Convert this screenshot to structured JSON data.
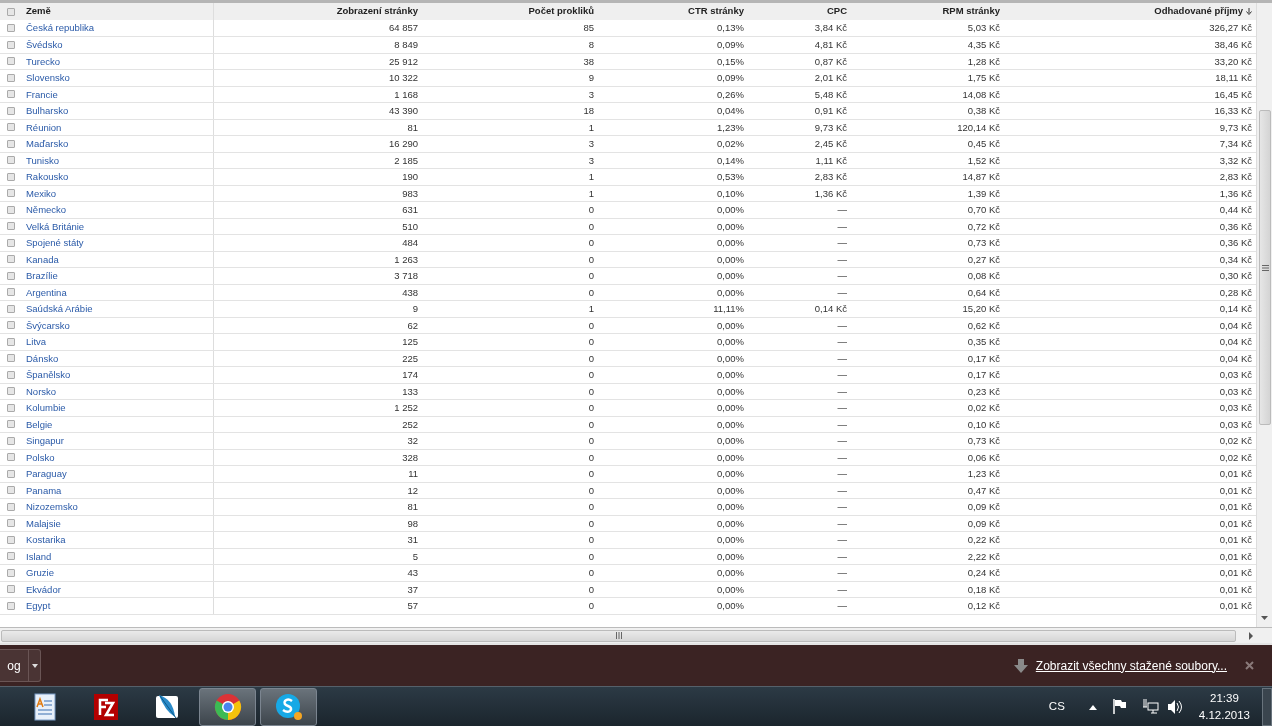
{
  "table": {
    "select_all_checked": false,
    "columns": [
      {
        "label": "Země",
        "sorted": false
      },
      {
        "label": "Zobrazení stránky",
        "sorted": false
      },
      {
        "label": "Počet prokliků",
        "sorted": false
      },
      {
        "label": "CTR stránky",
        "sorted": false
      },
      {
        "label": "CPC",
        "sorted": false
      },
      {
        "label": "RPM stránky",
        "sorted": false
      },
      {
        "label": "Odhadované příjmy",
        "sorted": true
      }
    ],
    "rows": [
      {
        "checked": false,
        "cells": [
          "Česká republika",
          "64 857",
          "85",
          "0,13%",
          "3,84 Kč",
          "5,03 Kč",
          "326,27 Kč"
        ]
      },
      {
        "checked": false,
        "cells": [
          "Švédsko",
          "8 849",
          "8",
          "0,09%",
          "4,81 Kč",
          "4,35 Kč",
          "38,46 Kč"
        ]
      },
      {
        "checked": false,
        "cells": [
          "Turecko",
          "25 912",
          "38",
          "0,15%",
          "0,87 Kč",
          "1,28 Kč",
          "33,20 Kč"
        ]
      },
      {
        "checked": false,
        "cells": [
          "Slovensko",
          "10 322",
          "9",
          "0,09%",
          "2,01 Kč",
          "1,75 Kč",
          "18,11 Kč"
        ]
      },
      {
        "checked": false,
        "cells": [
          "Francie",
          "1 168",
          "3",
          "0,26%",
          "5,48 Kč",
          "14,08 Kč",
          "16,45 Kč"
        ]
      },
      {
        "checked": false,
        "cells": [
          "Bulharsko",
          "43 390",
          "18",
          "0,04%",
          "0,91 Kč",
          "0,38 Kč",
          "16,33 Kč"
        ]
      },
      {
        "checked": false,
        "cells": [
          "Réunion",
          "81",
          "1",
          "1,23%",
          "9,73 Kč",
          "120,14 Kč",
          "9,73 Kč"
        ]
      },
      {
        "checked": false,
        "cells": [
          "Maďarsko",
          "16 290",
          "3",
          "0,02%",
          "2,45 Kč",
          "0,45 Kč",
          "7,34 Kč"
        ]
      },
      {
        "checked": false,
        "cells": [
          "Tunisko",
          "2 185",
          "3",
          "0,14%",
          "1,11 Kč",
          "1,52 Kč",
          "3,32 Kč"
        ]
      },
      {
        "checked": false,
        "cells": [
          "Rakousko",
          "190",
          "1",
          "0,53%",
          "2,83 Kč",
          "14,87 Kč",
          "2,83 Kč"
        ]
      },
      {
        "checked": false,
        "cells": [
          "Mexiko",
          "983",
          "1",
          "0,10%",
          "1,36 Kč",
          "1,39 Kč",
          "1,36 Kč"
        ]
      },
      {
        "checked": false,
        "cells": [
          "Německo",
          "631",
          "0",
          "0,00%",
          "—",
          "0,70 Kč",
          "0,44 Kč"
        ]
      },
      {
        "checked": false,
        "cells": [
          "Velká Británie",
          "510",
          "0",
          "0,00%",
          "—",
          "0,72 Kč",
          "0,36 Kč"
        ]
      },
      {
        "checked": false,
        "cells": [
          "Spojené státy",
          "484",
          "0",
          "0,00%",
          "—",
          "0,73 Kč",
          "0,36 Kč"
        ]
      },
      {
        "checked": false,
        "cells": [
          "Kanada",
          "1 263",
          "0",
          "0,00%",
          "—",
          "0,27 Kč",
          "0,34 Kč"
        ]
      },
      {
        "checked": false,
        "cells": [
          "Brazílie",
          "3 718",
          "0",
          "0,00%",
          "—",
          "0,08 Kč",
          "0,30 Kč"
        ]
      },
      {
        "checked": false,
        "cells": [
          "Argentina",
          "438",
          "0",
          "0,00%",
          "—",
          "0,64 Kč",
          "0,28 Kč"
        ]
      },
      {
        "checked": false,
        "cells": [
          "Saúdská Arábie",
          "9",
          "1",
          "11,11%",
          "0,14 Kč",
          "15,20 Kč",
          "0,14 Kč"
        ]
      },
      {
        "checked": false,
        "cells": [
          "Švýcarsko",
          "62",
          "0",
          "0,00%",
          "—",
          "0,62 Kč",
          "0,04 Kč"
        ]
      },
      {
        "checked": false,
        "cells": [
          "Litva",
          "125",
          "0",
          "0,00%",
          "—",
          "0,35 Kč",
          "0,04 Kč"
        ]
      },
      {
        "checked": false,
        "cells": [
          "Dánsko",
          "225",
          "0",
          "0,00%",
          "—",
          "0,17 Kč",
          "0,04 Kč"
        ]
      },
      {
        "checked": false,
        "cells": [
          "Španělsko",
          "174",
          "0",
          "0,00%",
          "—",
          "0,17 Kč",
          "0,03 Kč"
        ]
      },
      {
        "checked": false,
        "cells": [
          "Norsko",
          "133",
          "0",
          "0,00%",
          "—",
          "0,23 Kč",
          "0,03 Kč"
        ]
      },
      {
        "checked": false,
        "cells": [
          "Kolumbie",
          "1 252",
          "0",
          "0,00%",
          "—",
          "0,02 Kč",
          "0,03 Kč"
        ]
      },
      {
        "checked": false,
        "cells": [
          "Belgie",
          "252",
          "0",
          "0,00%",
          "—",
          "0,10 Kč",
          "0,03 Kč"
        ]
      },
      {
        "checked": false,
        "cells": [
          "Singapur",
          "32",
          "0",
          "0,00%",
          "—",
          "0,73 Kč",
          "0,02 Kč"
        ]
      },
      {
        "checked": false,
        "cells": [
          "Polsko",
          "328",
          "0",
          "0,00%",
          "—",
          "0,06 Kč",
          "0,02 Kč"
        ]
      },
      {
        "checked": false,
        "cells": [
          "Paraguay",
          "11",
          "0",
          "0,00%",
          "—",
          "1,23 Kč",
          "0,01 Kč"
        ]
      },
      {
        "checked": false,
        "cells": [
          "Panama",
          "12",
          "0",
          "0,00%",
          "—",
          "0,47 Kč",
          "0,01 Kč"
        ]
      },
      {
        "checked": false,
        "cells": [
          "Nizozemsko",
          "81",
          "0",
          "0,00%",
          "—",
          "0,09 Kč",
          "0,01 Kč"
        ]
      },
      {
        "checked": false,
        "cells": [
          "Malajsie",
          "98",
          "0",
          "0,00%",
          "—",
          "0,09 Kč",
          "0,01 Kč"
        ]
      },
      {
        "checked": false,
        "cells": [
          "Kostarika",
          "31",
          "0",
          "0,00%",
          "—",
          "0,22 Kč",
          "0,01 Kč"
        ]
      },
      {
        "checked": false,
        "cells": [
          "Island",
          "5",
          "0",
          "0,00%",
          "—",
          "2,22 Kč",
          "0,01 Kč"
        ]
      },
      {
        "checked": false,
        "cells": [
          "Gruzie",
          "43",
          "0",
          "0,00%",
          "—",
          "0,24 Kč",
          "0,01 Kč"
        ]
      },
      {
        "checked": false,
        "cells": [
          "Ekvádor",
          "37",
          "0",
          "0,00%",
          "—",
          "0,18 Kč",
          "0,01 Kč"
        ]
      },
      {
        "checked": false,
        "cells": [
          "Egypt",
          "57",
          "0",
          "0,00%",
          "—",
          "0,12 Kč",
          "0,01 Kč"
        ]
      }
    ]
  },
  "download_bar": {
    "item_label": "og",
    "show_all_link": "Zobrazit všechny stažené soubory..."
  },
  "taskbar": {
    "apps": [
      {
        "kind": "wordpad",
        "running": false
      },
      {
        "kind": "filezilla",
        "running": false
      },
      {
        "kind": "feather",
        "running": false
      },
      {
        "kind": "chrome",
        "running": true
      },
      {
        "kind": "skype",
        "running": true
      }
    ],
    "language": "CS",
    "clock_time": "21:39",
    "clock_date": "4.12.2013"
  }
}
